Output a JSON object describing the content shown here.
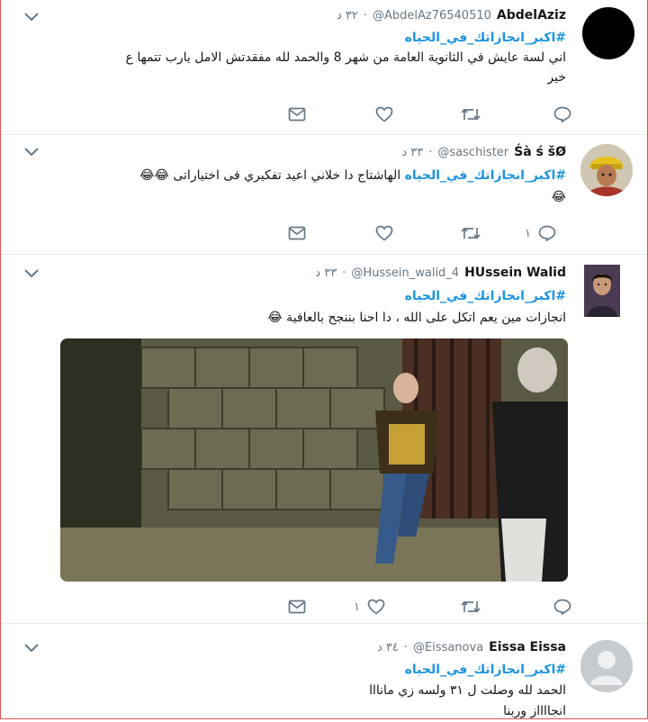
{
  "tweets": [
    {
      "name": "AbdelAziz",
      "handle": "@AbdelAz76540510",
      "time": "٣٢ د",
      "hashtag": "#اكبر_انجازاتك_في_الحياه",
      "lines": [
        "اني لسة عايش في الثانوية العامة من شهر 8 والحمد لله مفقدتش الامل يارب تتمها ع",
        "خير"
      ],
      "reply_count": "",
      "like_count": "",
      "avatar_icon": "black-circle-avatar"
    },
    {
      "name": "Śà ś šØ",
      "handle": "@saschister",
      "time": "٣٣ د",
      "hashtag": "#اكبر_انجازاتك_في_الحياه",
      "lines": [
        "الهاشتاج دا خلاني اعيد تفكيري فى اختياراتى 😂😂",
        "😂"
      ],
      "reply_count": "١",
      "like_count": "",
      "avatar_icon": "person-yellow-hat-avatar"
    },
    {
      "name": "HUssein Walid",
      "handle": "@Hussein_walid_4",
      "time": "٣٣ د",
      "hashtag": "#اكبر_انجازاتك_في_الحياه",
      "lines": [
        "انجازات مين يعم اتكل على الله ، دا احنا بننجح بالعافية 😂"
      ],
      "reply_count": "",
      "like_count": "١",
      "avatar_icon": "young-man-avatar",
      "media_icon": "movie-scene-image"
    },
    {
      "name": "Eissa Eissa",
      "handle": "@Eissanova",
      "time": "٣٤ د",
      "hashtag": "#اكبر_انجازاتك_في_الحياه",
      "lines": [
        "الحمد لله وصلت ل ٣١ ولسه زي مانااا",
        "انجااااز وربنا"
      ],
      "avatar_icon": "default-silhouette-avatar"
    }
  ],
  "colors": {
    "hashtag": "#1b95e0",
    "text": "#14171a",
    "muted": "#657786",
    "border": "#e6ecf0",
    "frame": "#d9534f"
  }
}
